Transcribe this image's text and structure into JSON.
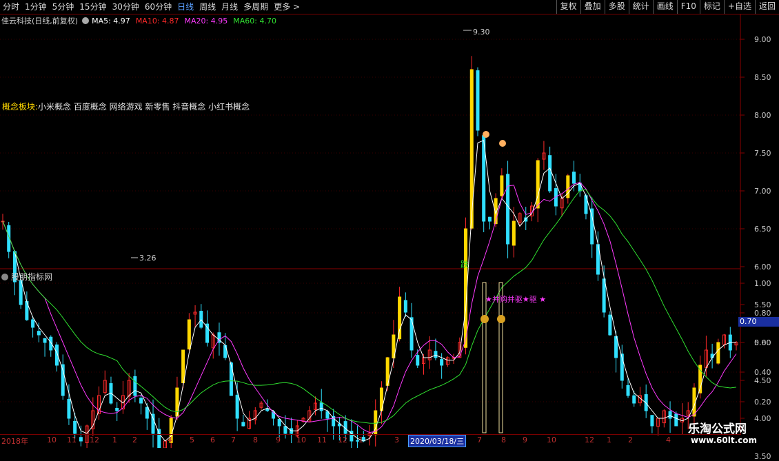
{
  "toolbar": {
    "periods": [
      "分时",
      "1分钟",
      "5分钟",
      "15分钟",
      "30分钟",
      "60分钟",
      "日线",
      "周线",
      "月线",
      "多周期",
      "更多 >"
    ],
    "active_period": "日线",
    "buttons": [
      "复权",
      "叠加",
      "多股",
      "统计",
      "画线",
      "F10",
      "标记",
      "+自选",
      "返回"
    ]
  },
  "legend": {
    "stock": "佳云科技(日线,前复权)",
    "ma5": "MA5: 4.97",
    "ma10": "MA10: 4.87",
    "ma20": "MA20: 4.95",
    "ma60": "MA60: 4.70"
  },
  "colors": {
    "ma5": "#ffffff",
    "ma10": "#ff2a2a",
    "ma20": "#ff3aff",
    "ma60": "#30e030",
    "up": "#ff2a2a",
    "down": "#30e0ff",
    "signal": "#ffd800"
  },
  "concept": {
    "label": "概念板块:",
    "value": "小米概念 百度概念 网络游戏 新零售 抖音概念 小红书概念"
  },
  "price_axis": [
    "9.00",
    "8.50",
    "8.00",
    "7.50",
    "7.00",
    "6.50",
    "6.00",
    "5.50",
    "5.00",
    "4.50",
    "4.00",
    "3.50"
  ],
  "annotations": {
    "high": "9.30",
    "low": "3.26",
    "die": "跌"
  },
  "indicator": {
    "title": "股朋指标网",
    "axis": [
      "1.00",
      "0.80",
      "0.60",
      "0.40",
      "0.20"
    ],
    "current": "0.70",
    "signal_text": "★并购并驱★驱 ★",
    "signal_icon": "money-bag-icon"
  },
  "dates": {
    "labels": [
      "2018年",
      "10",
      "11",
      "12",
      "1",
      "2",
      "4",
      "5",
      "6",
      "7",
      "8",
      "9",
      "10",
      "11",
      "12",
      "1",
      "3",
      "7",
      "8",
      "9",
      "10",
      "12",
      "1",
      "2",
      "4"
    ],
    "highlight": "2020/03/18/三"
  },
  "watermark": {
    "line1": "乐淘公式网",
    "line2": "www.60lt.com"
  },
  "chart_data": {
    "type": "candlestick",
    "ylim": [
      3.2,
      9.6
    ],
    "close": [
      6.6,
      6.2,
      5.8,
      5.5,
      5.3,
      5.2,
      5.1,
      5.0,
      4.9,
      4.7,
      4.3,
      4.0,
      3.8,
      3.7,
      3.9,
      4.1,
      4.3,
      4.5,
      4.2,
      4.1,
      4.3,
      4.5,
      4.3,
      4.2,
      4.0,
      3.8,
      3.6,
      3.7,
      4.0,
      4.4,
      4.9,
      5.3,
      5.4,
      5.2,
      5.0,
      5.1,
      5.0,
      4.8,
      4.3,
      4.0,
      3.9,
      4.0,
      4.1,
      4.2,
      4.1,
      4.0,
      3.9,
      3.8,
      3.8,
      3.9,
      4.0,
      4.1,
      4.2,
      4.1,
      4.0,
      3.9,
      3.9,
      3.8,
      3.7,
      3.7,
      3.7,
      3.8,
      4.1,
      4.4,
      4.8,
      5.1,
      5.6,
      5.4,
      4.9,
      4.7,
      4.8,
      4.9,
      4.8,
      4.7,
      4.8,
      4.8,
      5.0,
      6.5,
      8.6,
      7.8,
      6.6,
      6.6,
      6.9,
      7.2,
      6.3,
      6.6,
      6.7,
      6.6,
      6.8,
      7.4,
      7.5,
      7.0,
      6.8,
      6.9,
      7.2,
      7.1,
      7.0,
      6.7,
      6.3,
      5.9,
      5.4,
      5.1,
      4.8,
      4.5,
      4.3,
      4.2,
      4.3,
      4.1,
      3.9,
      4.0,
      4.1,
      4.0,
      3.9,
      4.0,
      4.1,
      4.4,
      4.7,
      4.9,
      4.8,
      5.0,
      5.1,
      4.9,
      5.0
    ]
  }
}
